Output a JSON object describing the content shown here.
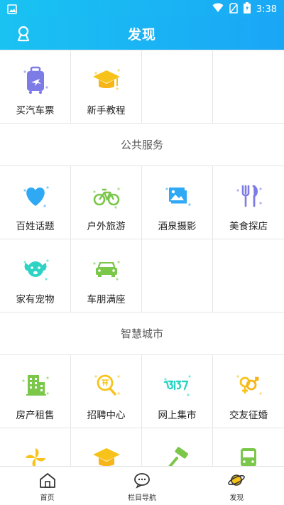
{
  "status_bar": {
    "time": "3:38"
  },
  "header": {
    "title": "发现"
  },
  "top_items": [
    {
      "label": "买汽车票",
      "icon": "luggage-bus-icon"
    },
    {
      "label": "新手教程",
      "icon": "graduation-cap-icon"
    }
  ],
  "section_public": {
    "title": "公共服务",
    "items": [
      {
        "label": "百姓话题",
        "icon": "heart-icon"
      },
      {
        "label": "户外旅游",
        "icon": "bicycle-icon"
      },
      {
        "label": "酒泉摄影",
        "icon": "photo-icon"
      },
      {
        "label": "美食探店",
        "icon": "fork-knife-icon"
      },
      {
        "label": "家有宠物",
        "icon": "dog-icon"
      },
      {
        "label": "车朋满座",
        "icon": "car-icon"
      }
    ]
  },
  "section_smart": {
    "title": "智慧城市",
    "items": [
      {
        "label": "房产租售",
        "icon": "building-icon"
      },
      {
        "label": "招聘中心",
        "icon": "recruit-search-icon"
      },
      {
        "label": "网上集市",
        "icon": "315-icon"
      },
      {
        "label": "交友征婚",
        "icon": "gender-rings-icon"
      }
    ]
  },
  "bottom_nav": [
    {
      "label": "首页",
      "icon": "home-icon"
    },
    {
      "label": "栏目导航",
      "icon": "chat-bubbles-icon"
    },
    {
      "label": "发现",
      "icon": "planet-icon"
    }
  ],
  "colors": {
    "header_start": "#1ac2f2",
    "header_end": "#1aa6f6",
    "blue": "#2fa9f4",
    "green": "#7bc74a",
    "yellow": "#f7c31a",
    "purple": "#7d7ce6",
    "teal": "#2ed3c4"
  }
}
